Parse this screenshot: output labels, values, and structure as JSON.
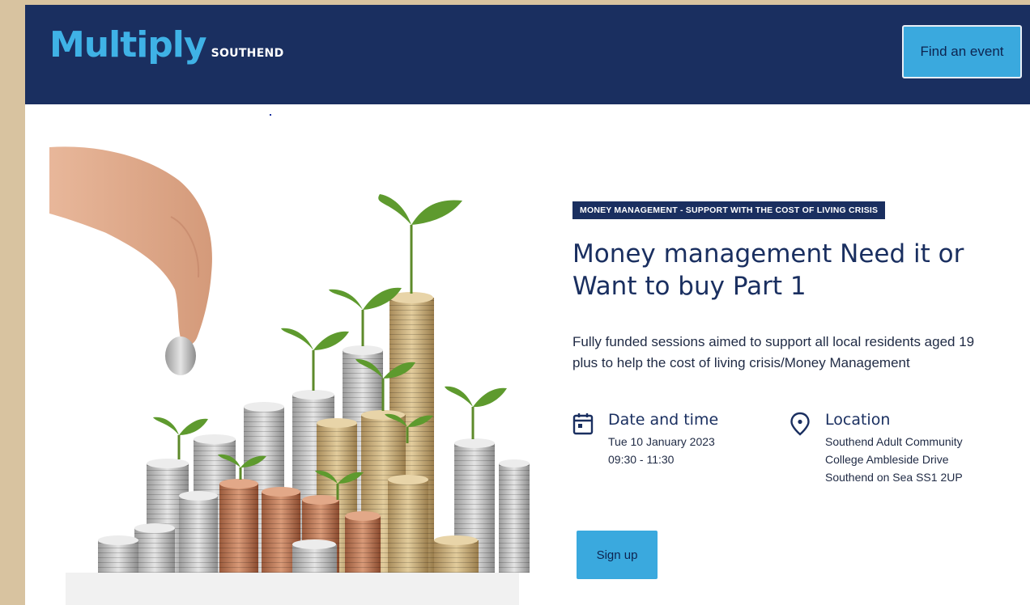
{
  "header": {
    "logo_main": "Multiply",
    "logo_sub": "SOUTHEND",
    "find_event_label": "Find an event"
  },
  "event": {
    "category_tag": "MONEY MANAGEMENT - SUPPORT WITH THE COST OF LIVING CRISIS",
    "title": "Money management Need it or Want to buy Part 1",
    "description": "Fully funded sessions aimed to support all local residents aged 19 plus to help the cost of living crisis/Money Management",
    "date_heading": "Date and time",
    "date": "Tue 10 January 2023",
    "time": "09:30 - 11:30",
    "location_heading": "Location",
    "location_lines": [
      "Southend Adult Community",
      "College Ambleside Drive",
      "Southend on Sea SS1 2UP"
    ],
    "signup_label": "Sign up"
  },
  "colors": {
    "brand_navy": "#1a2f60",
    "accent_blue": "#3aa9de",
    "logo_blue": "#3fb2e6"
  },
  "icons": {
    "calendar": "calendar-icon",
    "location": "location-pin-icon"
  }
}
